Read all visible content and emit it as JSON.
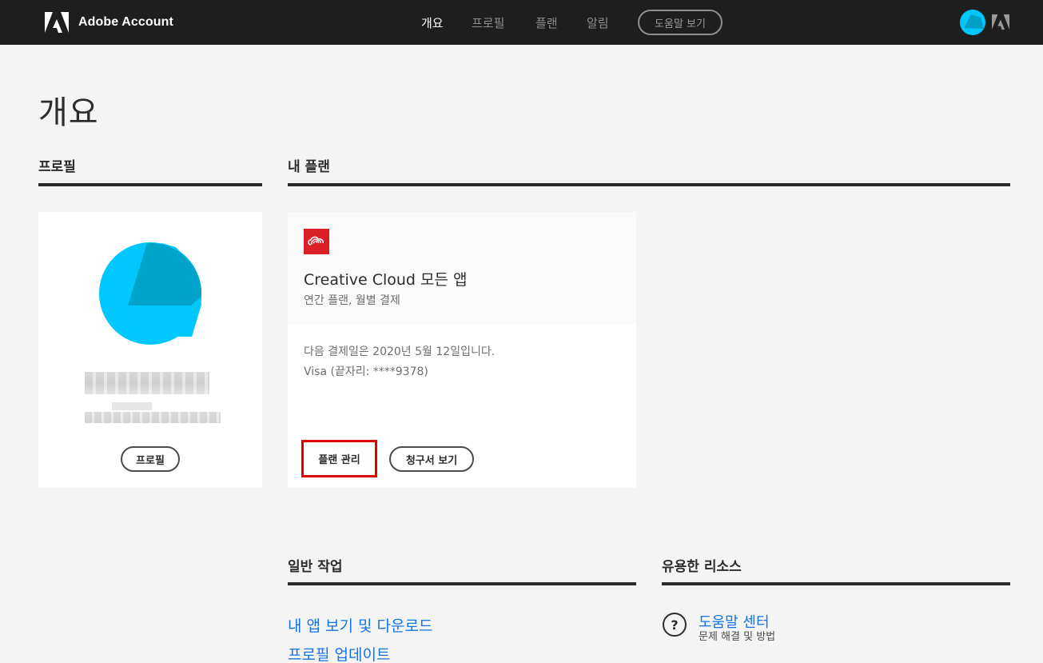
{
  "nav": {
    "brand": "Adobe Account",
    "items": [
      {
        "label": "개요",
        "active": true
      },
      {
        "label": "프로필",
        "active": false
      },
      {
        "label": "플랜",
        "active": false
      },
      {
        "label": "알림",
        "active": false
      }
    ],
    "help_label": "도움말 보기"
  },
  "page": {
    "title": "개요"
  },
  "sections": {
    "profile": "프로필",
    "my_plan": "내 플랜",
    "common_tasks": "일반 작업",
    "resources": "유용한 리소스"
  },
  "profile_card": {
    "button_label": "프로필"
  },
  "plan_card": {
    "name": "Creative Cloud 모든 앱",
    "subtitle": "연간 플랜, 월별 결제",
    "next_billing": "다음 결제일은 2020년 5월 12일입니다.",
    "payment": "Visa (끝자리: ****9378)",
    "manage_label": "플랜 관리",
    "invoice_label": "청구서 보기"
  },
  "common_tasks": {
    "links": [
      "내 앱 보기 및 다운로드",
      "프로필 업데이트"
    ]
  },
  "resources": {
    "help_center": "도움말 센터",
    "help_center_sub": "문제 해결 및 방법"
  },
  "colors": {
    "nav_bg": "#1e1e1e",
    "page_bg": "#f4f4f4",
    "link": "#1473e6",
    "avatar": "#00c8ff",
    "avatar_dark": "#00a6cc",
    "highlight": "#e00000",
    "cc_red": "#da1f26"
  },
  "icons": [
    "adobe-logo-icon",
    "avatar-icon",
    "creative-cloud-icon",
    "help-question-icon"
  ]
}
